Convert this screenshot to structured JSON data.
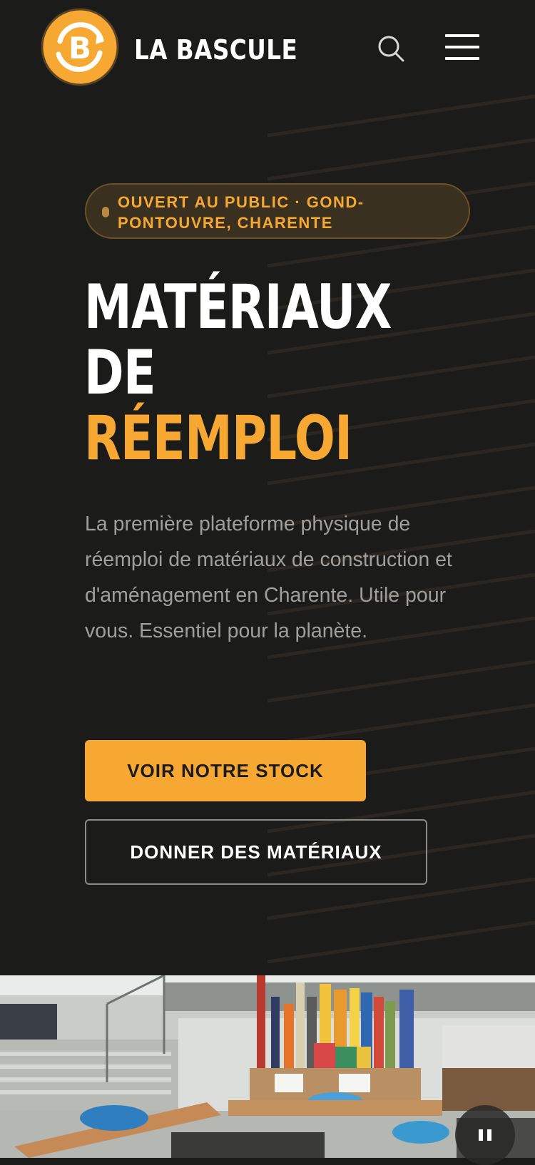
{
  "header": {
    "brand_name": "LA BASCULE",
    "logo_icon": "bascule-b-logo-icon",
    "search_icon": "search-icon",
    "menu_icon": "hamburger-menu-icon"
  },
  "hero": {
    "badge": "OUVERT AU PUBLIC · GOND-PONTOUVRE, CHARENTE",
    "title_line1": "MATÉRIAUX",
    "title_line2": "DE",
    "title_accent": "RÉEMPLOI",
    "description": "La première plateforme physique de réemploi de matériaux de construction et d'aménagement en Charente. Utile pour vous. Essentiel pour la planète.",
    "primary_button": "VOIR NOTRE STOCK",
    "secondary_button": "DONNER DES MATÉRIAUX"
  },
  "media": {
    "pause_icon": "pause-icon"
  },
  "colors": {
    "background": "#1b1b1a",
    "accent": "#f6a833",
    "text_primary": "#ffffff",
    "text_muted": "#a09f9b"
  }
}
